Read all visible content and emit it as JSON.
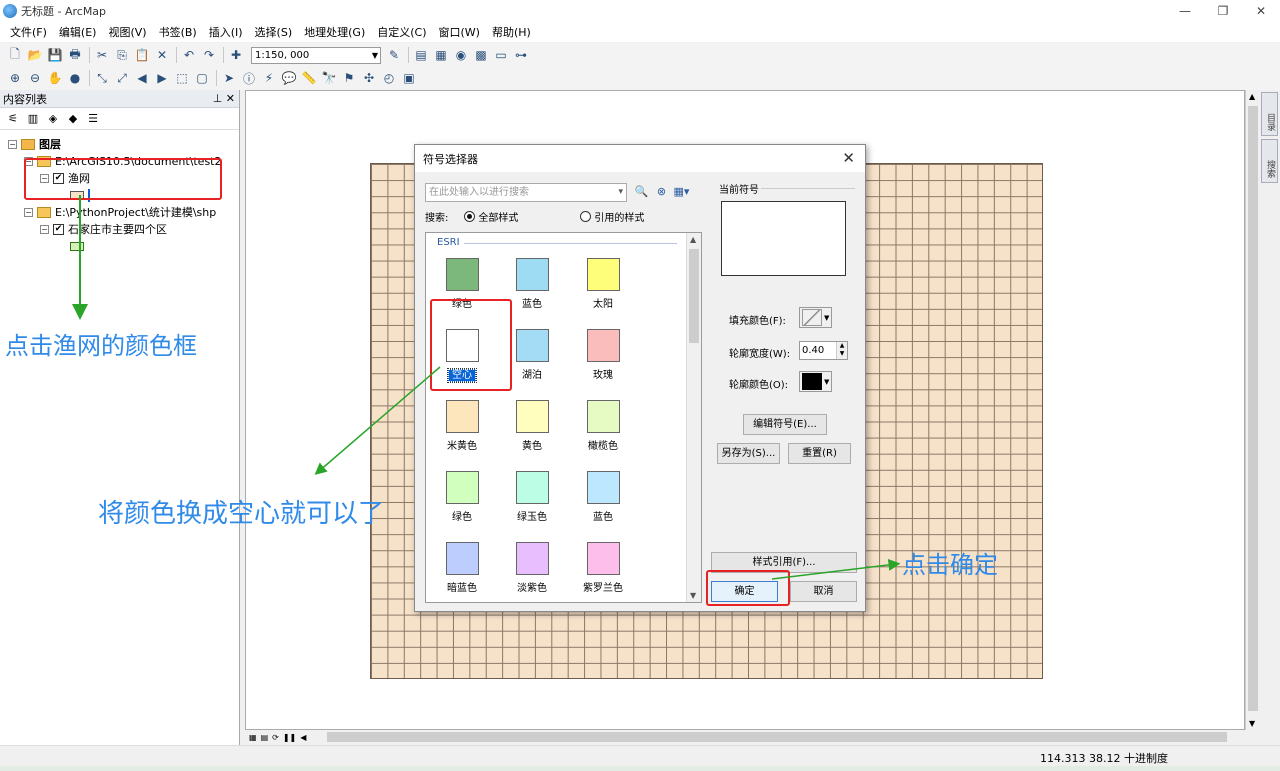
{
  "window": {
    "title": "无标题 - ArcMap",
    "controls": [
      "—",
      "❐",
      "✕"
    ]
  },
  "menu": [
    "文件(F)",
    "编辑(E)",
    "视图(V)",
    "书签(B)",
    "插入(I)",
    "选择(S)",
    "地理处理(G)",
    "自定义(C)",
    "窗口(W)",
    "帮助(H)"
  ],
  "toolbar": {
    "scale": "1:150, 000"
  },
  "toc": {
    "title": "内容列表",
    "root": "图层",
    "groups": [
      {
        "path": "E:\\ArcGIS10.5\\document\\test2",
        "layer": "渔网",
        "swatch": "#f6e1c9"
      },
      {
        "path": "E:\\PythonProject\\统计建模\\shp",
        "layer": "石家庄市主要四个区",
        "swatch": "#d8f0b8"
      }
    ]
  },
  "right_dock": [
    "目录",
    "搜索"
  ],
  "dialog": {
    "title": "符号选择器",
    "search_placeholder": "在此处输入以进行搜索",
    "search_label": "搜索:",
    "radio_all": "全部样式",
    "radio_ref": "引用的样式",
    "gallery_header": "ESRI",
    "symbols": [
      {
        "label": "绿色",
        "color": "#7cb87c"
      },
      {
        "label": "蓝色",
        "color": "#9ddcf3"
      },
      {
        "label": "太阳",
        "color": "#fffe7a"
      },
      {
        "label": "空心",
        "color": "#ffffff",
        "selected": true
      },
      {
        "label": "湖泊",
        "color": "#a3dcf4"
      },
      {
        "label": "玫瑰",
        "color": "#fbbcbc"
      },
      {
        "label": "米黄色",
        "color": "#fde5bc"
      },
      {
        "label": "黄色",
        "color": "#fffebe"
      },
      {
        "label": "橄榄色",
        "color": "#e5fbc3"
      },
      {
        "label": "绿色",
        "color": "#d1ffbe"
      },
      {
        "label": "绿玉色",
        "color": "#bcfde5"
      },
      {
        "label": "蓝色",
        "color": "#bde7ff"
      },
      {
        "label": "暗蓝色",
        "color": "#bdcefe"
      },
      {
        "label": "淡紫色",
        "color": "#e8befe"
      },
      {
        "label": "紫罗兰色",
        "color": "#fdbeeb"
      }
    ],
    "current_symbol": "当前符号",
    "fill_color_label": "填充颜色(F):",
    "outline_width_label": "轮廓宽度(W):",
    "outline_width": "0.40",
    "outline_color_label": "轮廓颜色(O):",
    "edit_symbol": "编辑符号(E)...",
    "save_as": "另存为(S)...",
    "reset": "重置(R)",
    "style_refs": "样式引用(F)...",
    "ok": "确定",
    "cancel": "取消"
  },
  "status": {
    "coords": "114.313  38.12 十进制度"
  },
  "annotations": {
    "click_grid_color": "点击渔网的颜色框",
    "change_to_hollow": "将颜色换成空心就可以了",
    "click_ok": "点击确定"
  }
}
